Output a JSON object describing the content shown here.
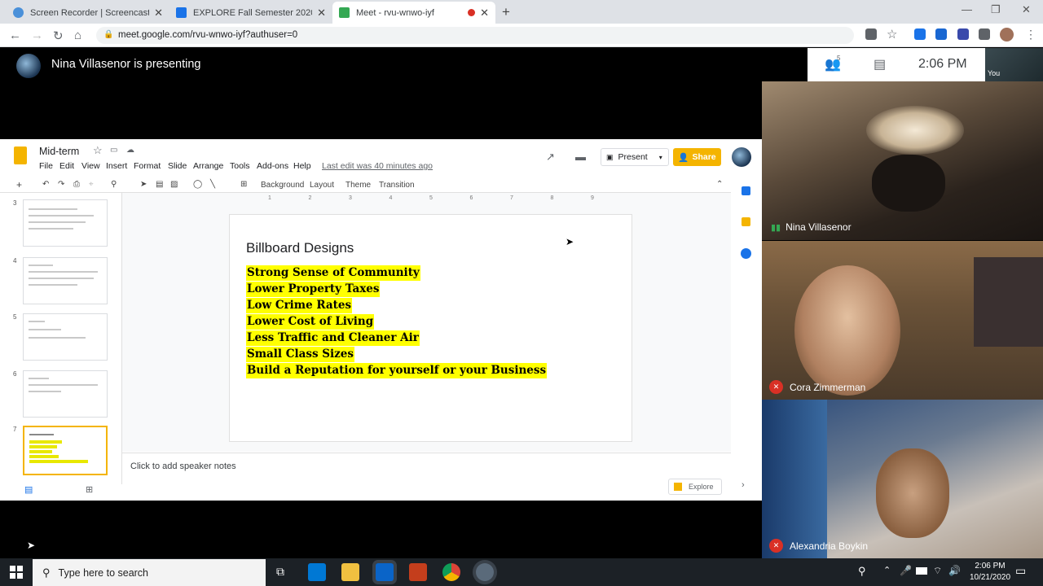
{
  "browser": {
    "tabs": [
      {
        "title": "Screen Recorder | Screencast-O-Matic",
        "color": "#1a73e8"
      },
      {
        "title": "EXPLORE Fall Semester 2020",
        "color": "#1a73e8"
      },
      {
        "title": "Meet - rvu-wnwo-iyf",
        "color": "#34a853"
      }
    ],
    "new_tab": "+",
    "url": "meet.google.com/rvu-wnwo-iyf?authuser=0"
  },
  "meet": {
    "presenting": "Nina Villasenor is presenting",
    "participant_count": "5",
    "time": "2:06 PM",
    "you_label": "You",
    "participants": [
      {
        "name": "Nina Villasenor",
        "muted": false
      },
      {
        "name": "Cora Zimmerman",
        "muted": true
      },
      {
        "name": "Alexandria Boykin",
        "muted": true
      }
    ]
  },
  "slides": {
    "doc_title": "Mid-term",
    "menu": [
      "File",
      "Edit",
      "View",
      "Insert",
      "Format",
      "Slide",
      "Arrange",
      "Tools",
      "Add-ons",
      "Help"
    ],
    "last_edit": "Last edit was 40 minutes ago",
    "present_label": "Present",
    "share_label": "Share",
    "toolbar": {
      "background": "Background",
      "layout": "Layout",
      "theme": "Theme",
      "transition": "Transition"
    },
    "thumbnail_numbers": [
      "3",
      "4",
      "5",
      "6",
      "7"
    ],
    "slide_title": "Billboard Designs",
    "bullets": [
      "Strong Sense of Community",
      "Lower Property Taxes",
      "Low Crime Rates",
      "Lower Cost of Living",
      "Less Traffic and Cleaner Air",
      "Small Class Sizes",
      "Build a Reputation for yourself or your Business"
    ],
    "speaker_notes": "Click to add speaker notes",
    "explore_label": "Explore",
    "ruler": [
      "1",
      "2",
      "3",
      "4",
      "5",
      "6",
      "7",
      "8",
      "9"
    ]
  },
  "taskbar": {
    "search_placeholder": "Type here to search",
    "time": "2:06 PM",
    "date": "10/21/2020"
  }
}
